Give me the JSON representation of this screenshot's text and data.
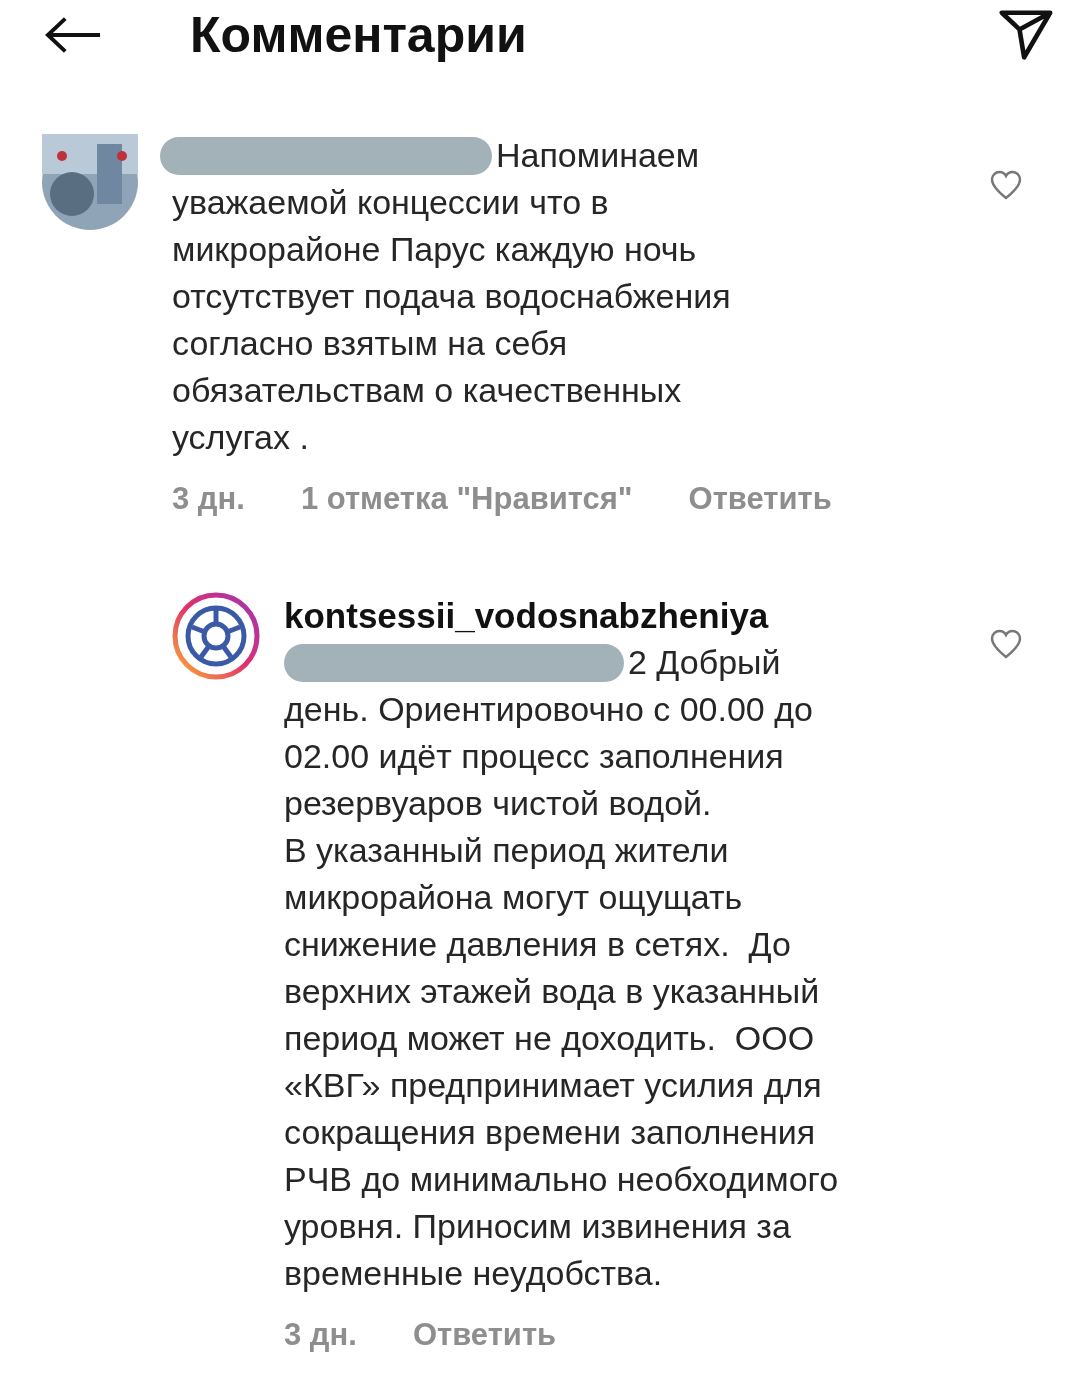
{
  "header": {
    "title": "Комментарии"
  },
  "comments": [
    {
      "avatar": {
        "kind": "photo"
      },
      "text": "Напоминаем\nуважаемой концессии что в\nмикрорайоне Парус каждую ночь\nотсутствует подача водоснабжения\nсогласно взятым на себя\nобязательствам о качественных\nуслугах .",
      "time": "3 дн.",
      "likes": "1 отметка \"Нравится\"",
      "reply": "Ответить",
      "liked": false
    },
    {
      "author": "kontsessii_vodosnabzheniya",
      "avatar": {
        "kind": "logo"
      },
      "text": "2 Добрый\nдень. Ориентировочно с 00.00 до\n02.00 идёт процесс заполнения\nрезервуаров чистой водой.\nВ указанный период жители\nмикрорайона могут ощущать\nснижение давления в сетях.  До\nверхних этажей вода в указанный\nпериод может не доходить.  ООО\n«КВГ» предпринимает усилия для\nсокращения времени заполнения\nРЧВ до минимально необходимого\nуровня. Приносим извинения за\nвременные неудобства.",
      "time": "3 дн.",
      "reply": "Ответить",
      "liked": false
    }
  ]
}
